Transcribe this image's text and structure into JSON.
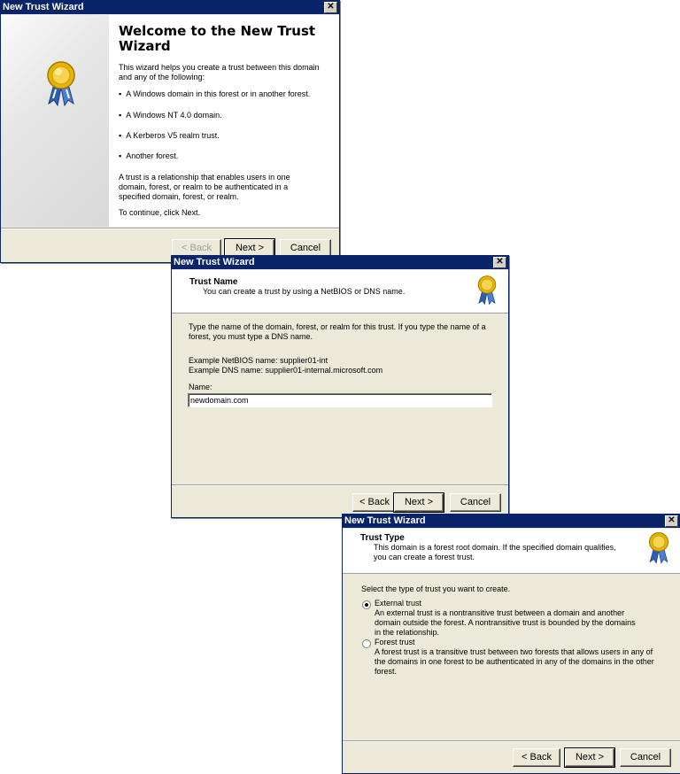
{
  "w1": {
    "title": "New Trust Wizard",
    "close": "✕",
    "heading": "Welcome to the New Trust Wizard",
    "intro": "This wizard helps you create a trust between this domain and any of the following:",
    "bullets": [
      "A Windows domain in this forest or in another forest.",
      "A Windows NT 4.0 domain.",
      "A Kerberos V5 realm trust.",
      "Another forest."
    ],
    "description": "A trust is a relationship that enables users in one domain, forest, or realm to be authenticated in a specified domain, forest, or realm.",
    "continue_text": "To continue, click Next.",
    "buttons": {
      "back": "< Back",
      "next": "Next >",
      "cancel": "Cancel"
    }
  },
  "w2": {
    "title": "New Trust Wizard",
    "close": "✕",
    "header_title": "Trust Name",
    "header_subtitle": "You can create a trust by using a NetBIOS or DNS name.",
    "instructions": "Type the name of the domain, forest, or realm for this trust. If you type the name of a forest, you must type a DNS name.",
    "example_netbios": "Example NetBIOS name: supplier01-int",
    "example_dns": "Example DNS name: supplier01-internal.microsoft.com",
    "name_label": "Name:",
    "name_value": "newdomain.com",
    "buttons": {
      "back": "< Back",
      "next": "Next >",
      "cancel": "Cancel"
    }
  },
  "w3": {
    "title": "New Trust Wizard",
    "close": "✕",
    "header_title": "Trust Type",
    "header_subtitle": "This domain is a forest root domain. If the specified domain qualifies, you can create a forest trust.",
    "prompt": "Select the type of trust you want to create.",
    "options": [
      {
        "label": "External trust",
        "description": "An external trust is a nontransitive trust between a domain and another domain outside the forest. A nontransitive trust is bounded by the domains in the relationship.",
        "selected": true
      },
      {
        "label": "Forest trust",
        "description": "A forest trust is a transitive trust between two forests that allows users in any of the domains in one forest to be authenticated in any of the domains in the other forest.",
        "selected": false
      }
    ],
    "buttons": {
      "back": "< Back",
      "next": "Next >",
      "cancel": "Cancel"
    }
  },
  "colors": {
    "titlebar": "#0a246a",
    "dialog": "#ece9d8",
    "medal_gold": "#e8b400",
    "ribbon_blue": "#2d5fb8"
  },
  "icons": {
    "wizard": "award-medal-icon"
  }
}
